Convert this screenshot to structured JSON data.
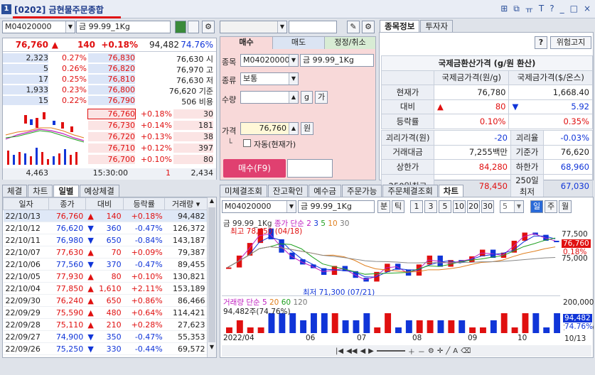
{
  "window": {
    "num": "1",
    "title": "[0202] 금현물주문종합",
    "buttons": [
      "⊞",
      "⧉",
      "ㅠ",
      "T",
      "?",
      "_",
      "□",
      "×"
    ]
  },
  "code": {
    "value": "M04020000",
    "name": "금 99.99_1Kg"
  },
  "summary": {
    "price": "76,760",
    "arrow": "▲",
    "change": "140",
    "rate": "+0.18%",
    "volume": "94,482",
    "ratio": "74.76%"
  },
  "asks": [
    {
      "qty": "2,323",
      "pct": "0.27%",
      "price": "76,830",
      "lab": "76,630 시"
    },
    {
      "qty": "5",
      "pct": "0.26%",
      "price": "76,820",
      "lab": "76,970 고"
    },
    {
      "qty": "17",
      "pct": "0.25%",
      "price": "76,810",
      "lab": "76,630 저"
    },
    {
      "qty": "1,933",
      "pct": "0.23%",
      "price": "76,800",
      "lab": "76,620 기준"
    },
    {
      "qty": "15",
      "pct": "0.22%",
      "price": "76,790",
      "lab": "506 비용"
    }
  ],
  "bids": [
    {
      "price": "76,760",
      "pct": "+0.18%",
      "qty": "30"
    },
    {
      "price": "76,730",
      "pct": "+0.14%",
      "qty": "181"
    },
    {
      "price": "76,720",
      "pct": "+0.13%",
      "qty": "38"
    },
    {
      "price": "76,710",
      "pct": "+0.12%",
      "qty": "397"
    },
    {
      "price": "76,700",
      "pct": "+0.10%",
      "qty": "80"
    }
  ],
  "ob_footer": {
    "ask_total": "4,463",
    "time": "15:30:00",
    "mid": "1",
    "bid_total": "2,434"
  },
  "order": {
    "tabs": [
      "매수",
      "매도",
      "정정/취소"
    ],
    "labels": {
      "code": "종목",
      "type": "종류",
      "qty": "수량",
      "price": "가격"
    },
    "type_val": "보통",
    "g_btn": "g",
    "ga_btn": "가",
    "price_val": "76,760",
    "won": "원",
    "auto": "자동(현재가)",
    "submit": "매수(F9)"
  },
  "info": {
    "tabs": [
      "종목정보",
      "투자자"
    ],
    "help": "?",
    "risk": "위험고지",
    "title": "국제금환산가격 (g/원 환산)",
    "col1": "국제금가격(원/g)",
    "col2": "국제금가격($/온스)",
    "rows": [
      {
        "l": "현재가",
        "v1": "76,780",
        "v2": "1,668.40"
      },
      {
        "l": "대비",
        "v1": "80",
        "v2": "5.92"
      },
      {
        "l": "등락률",
        "v1": "0.10%",
        "v2": "0.35%"
      }
    ],
    "rows2": [
      {
        "l": "괴리가격(원)",
        "v": "-20",
        "l2": "괴리율",
        "v2": "-0.03%"
      },
      {
        "l": "거래대금",
        "v": "7,255백만",
        "l2": "기준가",
        "v2": "76,620"
      },
      {
        "l": "상한가",
        "v": "84,280",
        "l2": "하한가",
        "v2": "68,960"
      },
      {
        "l": "250일최고",
        "v": "78,450",
        "l2": "250일최저",
        "v2": "67,030"
      }
    ]
  },
  "daily": {
    "tabs": [
      "체결",
      "차트",
      "일별",
      "예상체결"
    ],
    "headers": [
      "일자",
      "종가",
      "대비",
      "등락률",
      "거래량"
    ],
    "rows": [
      {
        "d": "22/10/13",
        "c": "76,760",
        "s": "up",
        "ch": "140",
        "r": "+0.18%",
        "v": "94,482"
      },
      {
        "d": "22/10/12",
        "c": "76,620",
        "s": "dn",
        "ch": "360",
        "r": "-0.47%",
        "v": "126,372"
      },
      {
        "d": "22/10/11",
        "c": "76,980",
        "s": "dn",
        "ch": "650",
        "r": "-0.84%",
        "v": "143,187"
      },
      {
        "d": "22/10/07",
        "c": "77,630",
        "s": "up",
        "ch": "70",
        "r": "+0.09%",
        "v": "79,387"
      },
      {
        "d": "22/10/06",
        "c": "77,560",
        "s": "dn",
        "ch": "370",
        "r": "-0.47%",
        "v": "89,455"
      },
      {
        "d": "22/10/05",
        "c": "77,930",
        "s": "up",
        "ch": "80",
        "r": "+0.10%",
        "v": "130,821"
      },
      {
        "d": "22/10/04",
        "c": "77,850",
        "s": "up",
        "ch": "1,610",
        "r": "+2.11%",
        "v": "153,189"
      },
      {
        "d": "22/09/30",
        "c": "76,240",
        "s": "up",
        "ch": "650",
        "r": "+0.86%",
        "v": "86,466"
      },
      {
        "d": "22/09/29",
        "c": "75,590",
        "s": "up",
        "ch": "480",
        "r": "+0.64%",
        "v": "114,421"
      },
      {
        "d": "22/09/28",
        "c": "75,110",
        "s": "up",
        "ch": "210",
        "r": "+0.28%",
        "v": "27,623"
      },
      {
        "d": "22/09/27",
        "c": "74,900",
        "s": "dn",
        "ch": "350",
        "r": "-0.47%",
        "v": "55,353"
      },
      {
        "d": "22/09/26",
        "c": "75,250",
        "s": "dn",
        "ch": "330",
        "r": "-0.44%",
        "v": "69,572"
      }
    ]
  },
  "chart": {
    "tabs": [
      "미체결조회",
      "잔고확인",
      "예수금",
      "주문가능",
      "주문체결조회",
      "차트"
    ],
    "periods": [
      "1",
      "3",
      "5",
      "10",
      "20",
      "30"
    ],
    "sel": "5",
    "bun": "분",
    "tick": "틱",
    "il": "일",
    "ju": "주",
    "wol": "월",
    "legend": "금 99.99_1Kg",
    "ma": "종가 단순 2",
    "ma_n": [
      "3",
      "5",
      "10",
      "30"
    ],
    "hi": "최고 78,450 (04/18)",
    "lo": "최저 71,300 (07/21)",
    "vol_legend": "거래량 단순 5",
    "vol_n": [
      "20",
      "60",
      "120"
    ],
    "vol_note": "94,482주(74.76%)",
    "y_ticks": [
      "77,500",
      "75,000"
    ],
    "cur_price": "76,760",
    "cur_rate": "0.18%",
    "vol_ticks": [
      "200,000",
      "100,000"
    ],
    "cur_vol": "94,482",
    "cur_vr": "74.76%",
    "x_ticks": [
      "2022/04",
      "06",
      "07",
      "08",
      "09",
      "10"
    ],
    "last_date": "10/13"
  },
  "chart_data": {
    "type": "line",
    "title": "금 99.99_1Kg",
    "series": [
      {
        "name": "종가",
        "values": [
          73200,
          74800,
          76500,
          78450,
          77000,
          75200,
          74300,
          73600,
          73100,
          72200,
          73400,
          72700,
          71800,
          71300,
          72600,
          73700,
          72900,
          72100,
          73600,
          74800,
          73300,
          74200,
          73900,
          74700,
          75600,
          74500,
          75200,
          76800,
          77900,
          77600,
          76800,
          76760
        ]
      }
    ],
    "ylim": [
      70000,
      79000
    ]
  }
}
